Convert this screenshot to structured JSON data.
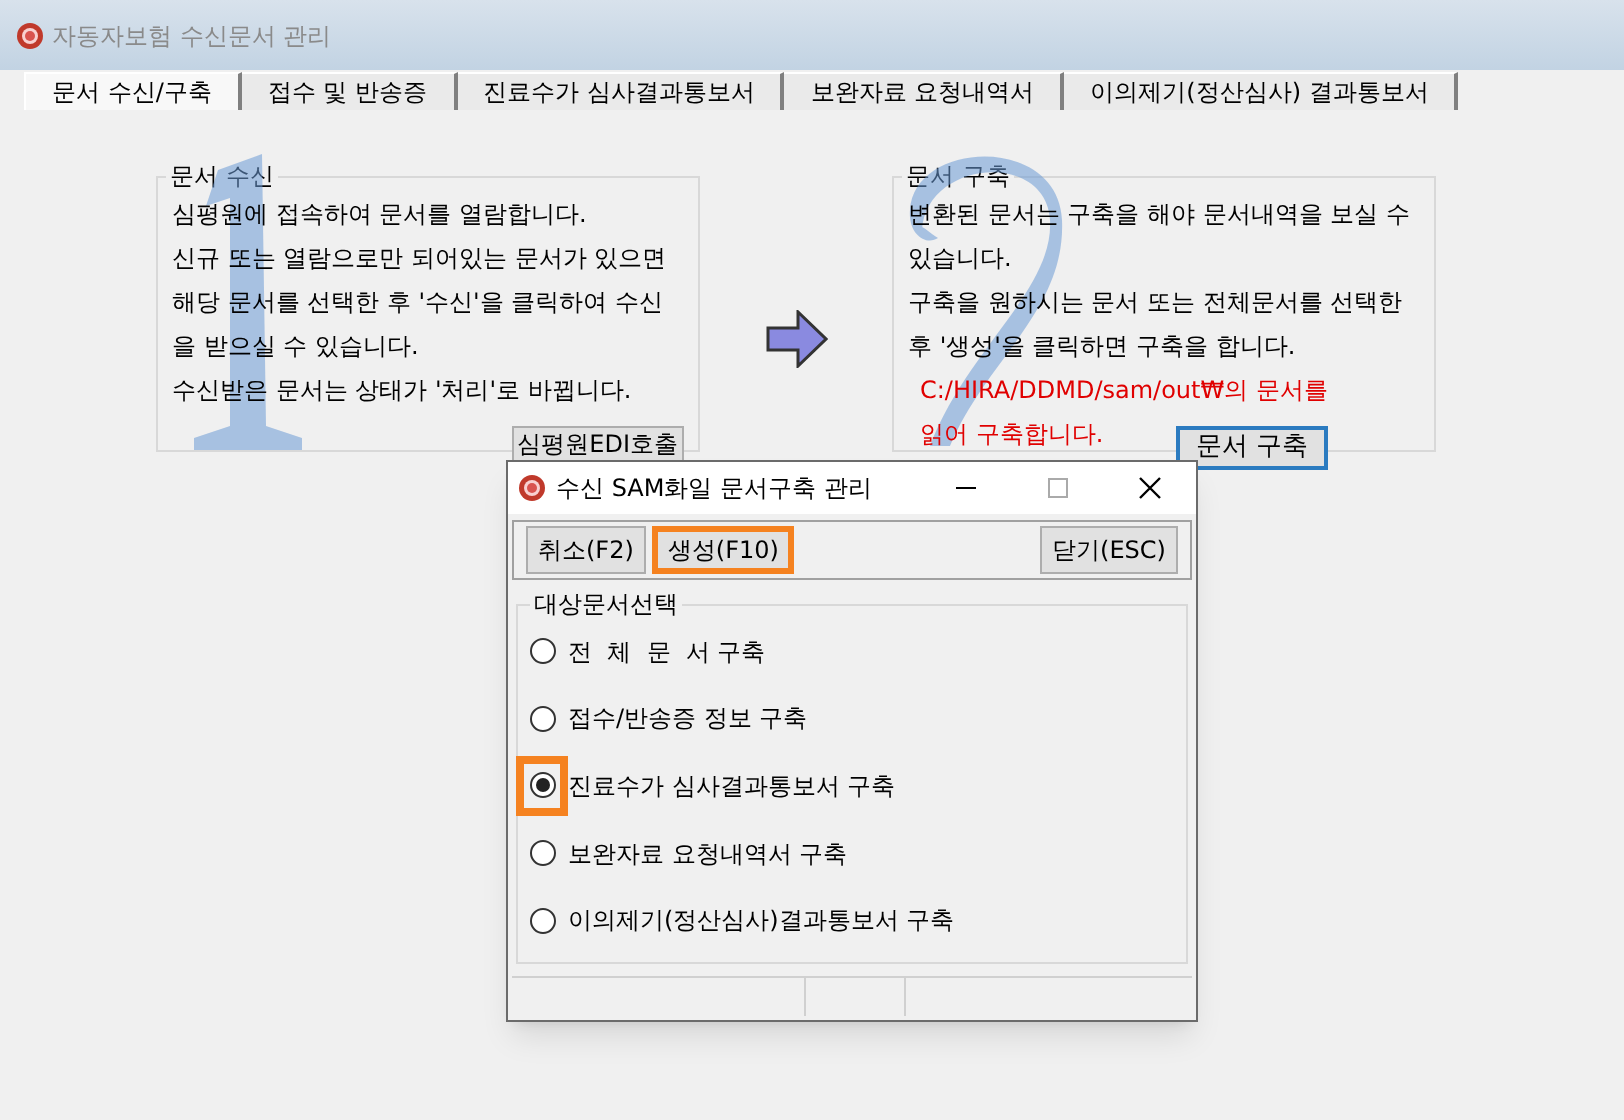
{
  "window": {
    "title": "자동자보험 수신문서 관리"
  },
  "tabs": [
    {
      "label": "문서 수신/구축",
      "selected": true
    },
    {
      "label": "접수 및 반송증",
      "selected": false
    },
    {
      "label": "진료수가 심사결과통보서",
      "selected": false
    },
    {
      "label": "보완자료 요청내역서",
      "selected": false
    },
    {
      "label": "이의제기(정산심사) 결과통보서",
      "selected": false
    }
  ],
  "receive_panel": {
    "title": "문서 수신",
    "lines": [
      {
        "text": "심평원에 접속하여 문서를 열람합니다.",
        "kind": "normal"
      },
      {
        "text": "신규 또는 열람으로만 되어있는 문서가 있으면",
        "kind": "normal"
      },
      {
        "text": "해당 문서를 선택한 후 '수신'을 클릭하여 수신",
        "kind": "normal"
      },
      {
        "text": "을 받으실 수 있습니다.",
        "kind": "normal"
      },
      {
        "text": "수신받은 문서는 상태가 '처리'로 바뀝니다.",
        "kind": "normal"
      }
    ],
    "button": "심평원EDI호출"
  },
  "build_panel": {
    "title": "문서 구축",
    "lines": [
      {
        "text": "변환된 문서는 구축을 해야 문서내역을 보실 수",
        "kind": "normal"
      },
      {
        "text": "있습니다.",
        "kind": "normal"
      },
      {
        "text": "구축을 원하시는 문서 또는 전체문서를 선택한",
        "kind": "normal"
      },
      {
        "text": "후 '생성'을 클릭하면 구축을 합니다.",
        "kind": "normal"
      },
      {
        "text": "C:/HIRA/DDMD/sam/out₩의 문서를",
        "kind": "warning"
      },
      {
        "text": "읽어 구축합니다.",
        "kind": "warning"
      }
    ],
    "button": "문서 구축"
  },
  "dialog": {
    "title": "수신 SAM화일 문서구축 관리",
    "toolbar": [
      {
        "label": "취소(F2)",
        "highlighted": false
      },
      {
        "label": "생성(F10)",
        "highlighted": true
      },
      {
        "label": "닫기(ESC)",
        "highlighted": false
      }
    ],
    "group_title": "대상문서선택",
    "options": [
      {
        "label": "전  체  문  서 구축",
        "selected": false,
        "highlighted": false
      },
      {
        "label": "접수/반송증 정보 구축",
        "selected": false,
        "highlighted": false
      },
      {
        "label": "진료수가 심사결과통보서 구축",
        "selected": true,
        "highlighted": true
      },
      {
        "label": "보완자료 요청내역서 구축",
        "selected": false,
        "highlighted": false
      },
      {
        "label": "이의제기(정산심사)결과통보서 구축",
        "selected": false,
        "highlighted": false
      }
    ]
  }
}
